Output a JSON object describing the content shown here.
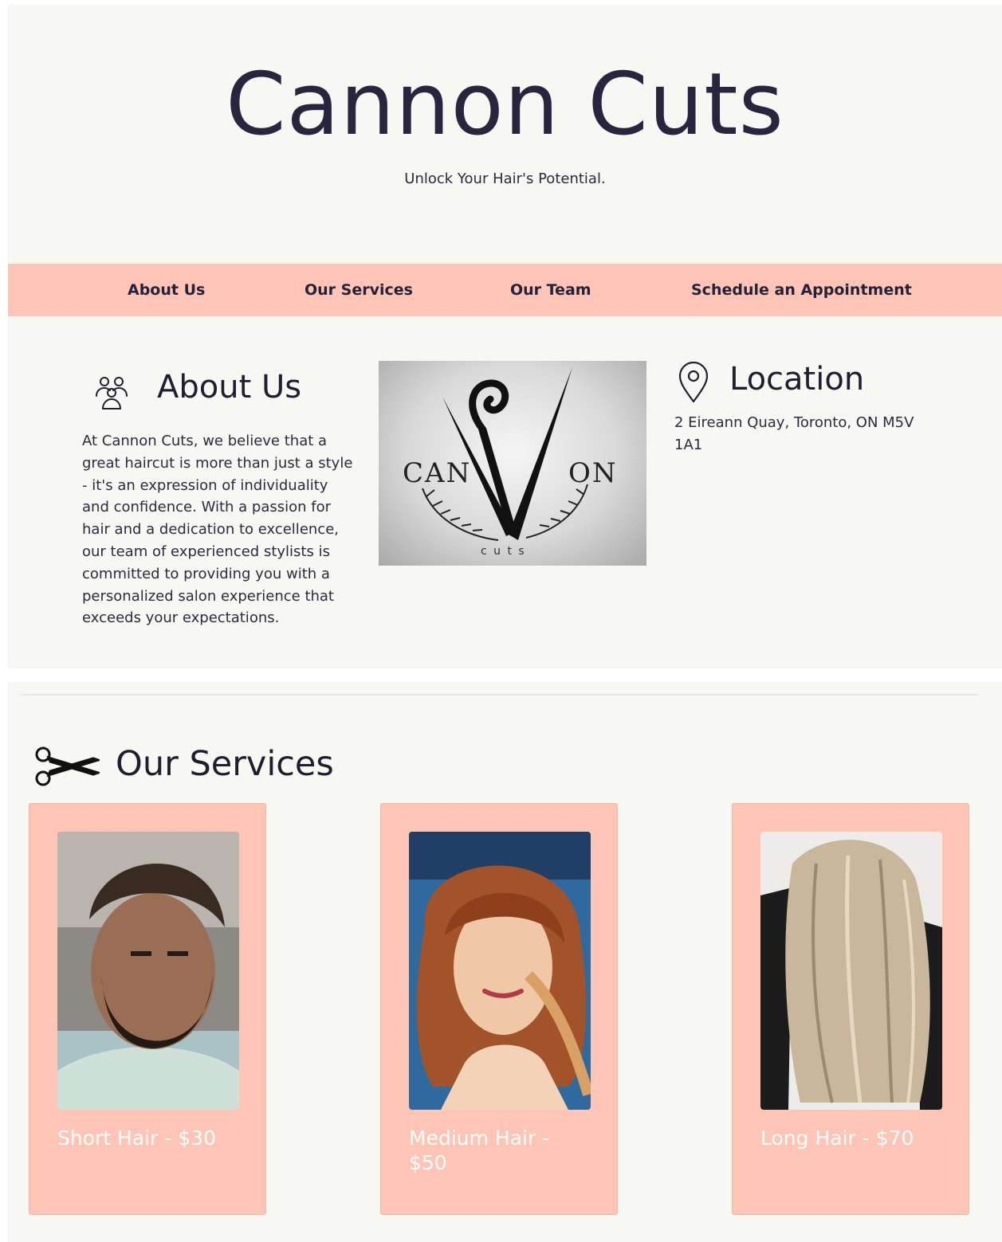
{
  "header": {
    "title": "Cannon Cuts",
    "tagline": "Unlock Your Hair's Potential."
  },
  "nav": {
    "items": [
      {
        "label": "About Us"
      },
      {
        "label": "Our Services"
      },
      {
        "label": "Our Team"
      },
      {
        "label": "Schedule an Appointment"
      }
    ]
  },
  "about": {
    "icon": "group-icon",
    "heading": "About Us",
    "text": "At Cannon Cuts, we believe that a great haircut is more than just a style - it's an expression of individuality and confidence. With a passion for hair and a dedication to excellence, our team of experienced stylists is committed to providing you with a personalized salon experience that exceeds your expectations."
  },
  "logo": {
    "wordmark_left": "CAN",
    "wordmark_right": "ON",
    "wordmark_sub": "c u t s"
  },
  "location": {
    "icon": "map-pin-icon",
    "heading": "Location",
    "address": "2 Eireann Quay, Toronto, ON M5V 1A1"
  },
  "services": {
    "icon": "scissors-icon",
    "heading": "Our Services",
    "items": [
      {
        "label": "Short Hair - $30"
      },
      {
        "label": "Medium Hair - $50"
      },
      {
        "label": "Long Hair - $70"
      }
    ]
  },
  "colors": {
    "accent": "#fec4b6",
    "background": "#f7f7f3",
    "text": "#2b2a40"
  }
}
